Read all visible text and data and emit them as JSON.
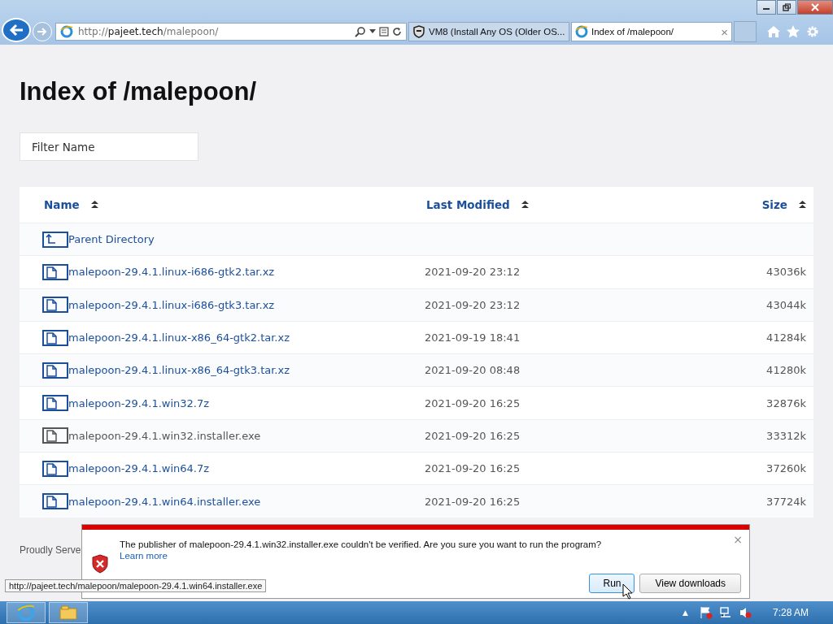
{
  "browser": {
    "address": {
      "prefix": "http://",
      "domain": "pajeet.tech",
      "path": "/malepoon/"
    },
    "tabs": [
      {
        "title": "VM8 (Install Any OS (Older OS...",
        "selected": false
      },
      {
        "title": "Index of /malepoon/",
        "selected": true,
        "close": "×"
      }
    ]
  },
  "page": {
    "heading": "Index of /malepoon/",
    "filter": {
      "placeholder": "Filter Name"
    },
    "columns": [
      {
        "label": "Name"
      },
      {
        "label": "Last Modified"
      },
      {
        "label": "Size"
      }
    ],
    "rows": [
      {
        "kind": "parent",
        "name": "Parent Directory",
        "visited": false
      },
      {
        "kind": "file",
        "name": "malepoon-29.4.1.linux-i686-gtk2.tar.xz",
        "modified": "2021-09-20 23:12",
        "size": "43036k",
        "visited": false
      },
      {
        "kind": "file",
        "name": "malepoon-29.4.1.linux-i686-gtk3.tar.xz",
        "modified": "2021-09-20 23:12",
        "size": "43044k",
        "visited": false
      },
      {
        "kind": "file",
        "name": "malepoon-29.4.1.linux-x86_64-gtk2.tar.xz",
        "modified": "2021-09-19 18:41",
        "size": "41284k",
        "visited": false
      },
      {
        "kind": "file",
        "name": "malepoon-29.4.1.linux-x86_64-gtk3.tar.xz",
        "modified": "2021-09-20 08:48",
        "size": "41280k",
        "visited": false
      },
      {
        "kind": "file",
        "name": "malepoon-29.4.1.win32.7z",
        "modified": "2021-09-20 16:25",
        "size": "32876k",
        "visited": false
      },
      {
        "kind": "file",
        "name": "malepoon-29.4.1.win32.installer.exe",
        "modified": "2021-09-20 16:25",
        "size": "33312k",
        "visited": true
      },
      {
        "kind": "file",
        "name": "malepoon-29.4.1.win64.7z",
        "modified": "2021-09-20 16:25",
        "size": "37260k",
        "visited": false
      },
      {
        "kind": "file",
        "name": "malepoon-29.4.1.win64.installer.exe",
        "modified": "2021-09-20 16:25",
        "size": "37724k",
        "visited": false
      }
    ],
    "footer": "Proudly Serve"
  },
  "status_url": "http://pajeet.tech/malepoon/malepoon-29.4.1.win64.installer.exe",
  "notification": {
    "message": "The publisher of malepoon-29.4.1.win32.installer.exe couldn't be verified. Are you sure you want to run the program?",
    "link": "Learn more",
    "close": "×",
    "buttons": [
      "Run",
      "View downloads"
    ]
  },
  "taskbar": {
    "clock": "7:28 AM",
    "tray_arrow": "▲"
  }
}
